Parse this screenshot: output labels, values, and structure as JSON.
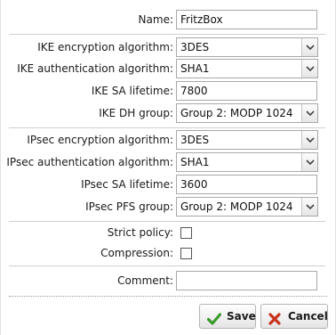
{
  "form": {
    "name": {
      "label": "Name:",
      "value": "FritzBox"
    },
    "ike": {
      "encryption": {
        "label": "IKE encryption algorithm:",
        "value": "3DES"
      },
      "authentication": {
        "label": "IKE authentication algorithm:",
        "value": "SHA1"
      },
      "sa_lifetime": {
        "label": "IKE SA lifetime:",
        "value": "7800"
      },
      "dh_group": {
        "label": "IKE DH group:",
        "value": "Group 2: MODP 1024"
      }
    },
    "ipsec": {
      "encryption": {
        "label": "IPsec encryption algorithm:",
        "value": "3DES"
      },
      "authentication": {
        "label": "IPsec authentication algorithm:",
        "value": "SHA1"
      },
      "sa_lifetime": {
        "label": "IPsec SA lifetime:",
        "value": "3600"
      },
      "pfs_group": {
        "label": "IPsec PFS group:",
        "value": "Group 2: MODP 1024"
      }
    },
    "strict_policy": {
      "label": "Strict policy:",
      "checked": false
    },
    "compression": {
      "label": "Compression:",
      "checked": false
    },
    "comment": {
      "label": "Comment:",
      "value": ""
    }
  },
  "buttons": {
    "save_label": "Save",
    "cancel_label": "Cancel"
  },
  "colors": {
    "save_icon": "#3a9a2c",
    "cancel_icon": "#c8321e"
  },
  "icons": {
    "save": "checkmark-icon",
    "cancel": "x-icon",
    "dropdown": "chevron-down-icon"
  }
}
